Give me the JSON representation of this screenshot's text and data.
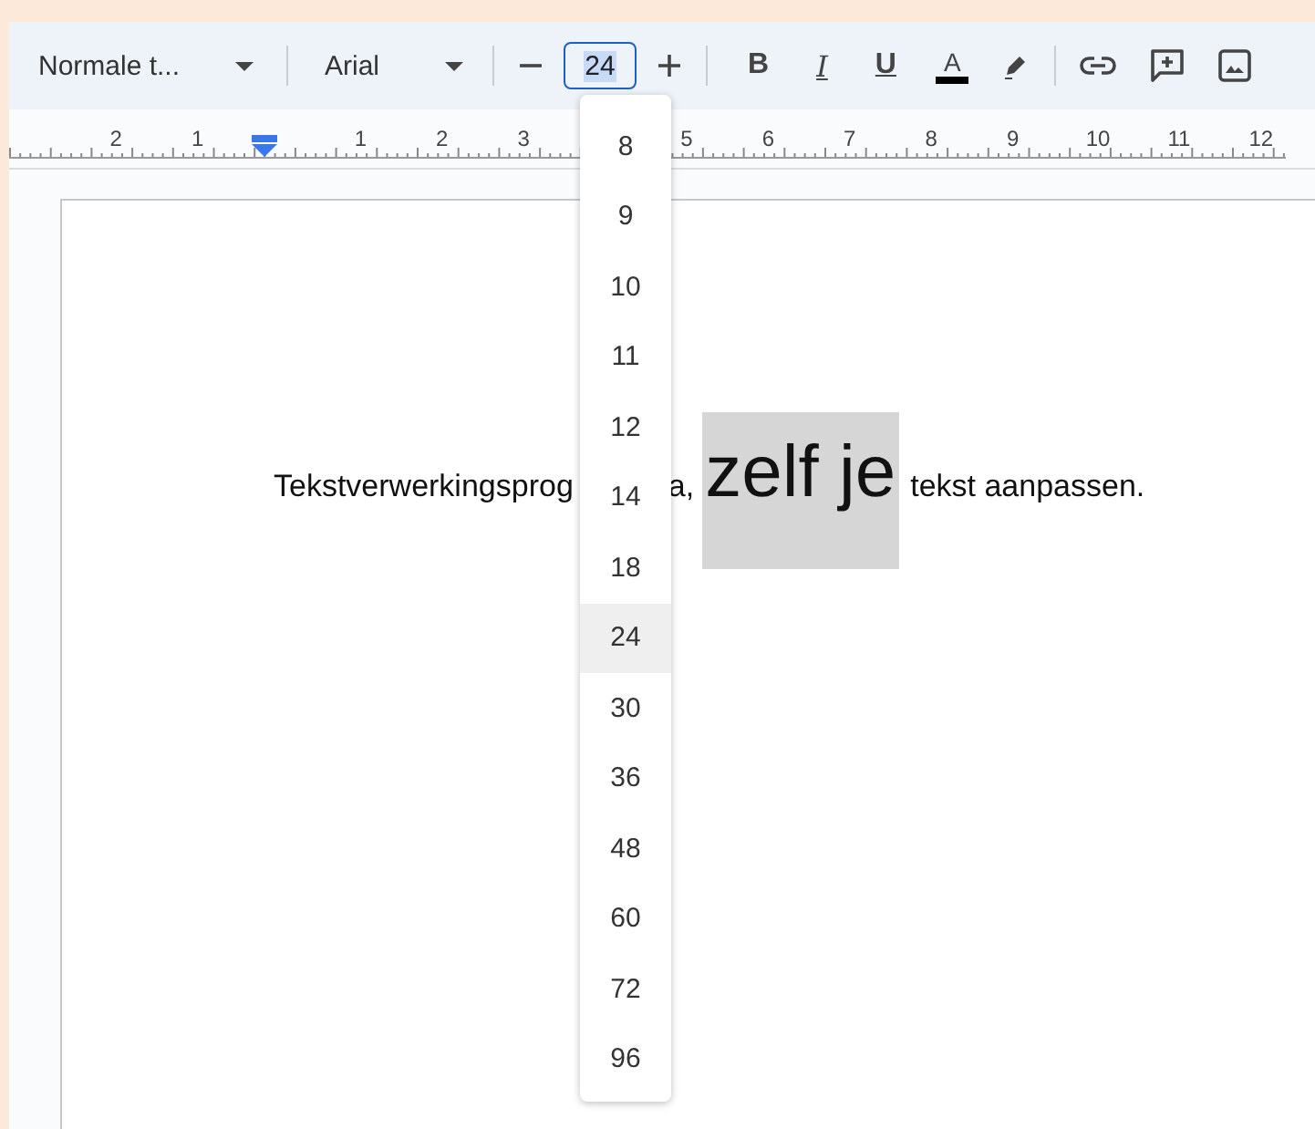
{
  "toolbar": {
    "style_menu": "Normale t...",
    "font_menu": "Arial",
    "font_size": "24",
    "format_buttons": [
      {
        "label": "B",
        "kind": "bold"
      },
      {
        "label": "I",
        "kind": "italic"
      },
      {
        "label": "U",
        "kind": "underline"
      },
      {
        "label": "A",
        "kind": "color"
      }
    ]
  },
  "ruler": {
    "left_numbers": [
      "2",
      "1"
    ],
    "right_numbers": [
      "1",
      "2",
      "3",
      "5",
      "6",
      "7",
      "8",
      "9",
      "10",
      "11",
      "12"
    ]
  },
  "document": {
    "segments": [
      {
        "text": "Tekstverwerkingsprog",
        "kind": "normal"
      },
      {
        "text": "a,",
        "kind": "normal"
      },
      {
        "text": "zelf je",
        "kind": "large-selected"
      },
      {
        "text": "tekst aanpassen.",
        "kind": "normal"
      }
    ]
  },
  "size_menu": {
    "items": [
      {
        "label": "8",
        "selected": false
      },
      {
        "label": "9",
        "selected": false
      },
      {
        "label": "10",
        "selected": false
      },
      {
        "label": "11",
        "selected": false
      },
      {
        "label": "12",
        "selected": false
      },
      {
        "label": "14",
        "selected": false
      },
      {
        "label": "18",
        "selected": false
      },
      {
        "label": "24",
        "selected": true
      },
      {
        "label": "30",
        "selected": false
      },
      {
        "label": "36",
        "selected": false
      },
      {
        "label": "48",
        "selected": false
      },
      {
        "label": "60",
        "selected": false
      },
      {
        "label": "72",
        "selected": false
      },
      {
        "label": "96",
        "selected": false
      }
    ]
  }
}
